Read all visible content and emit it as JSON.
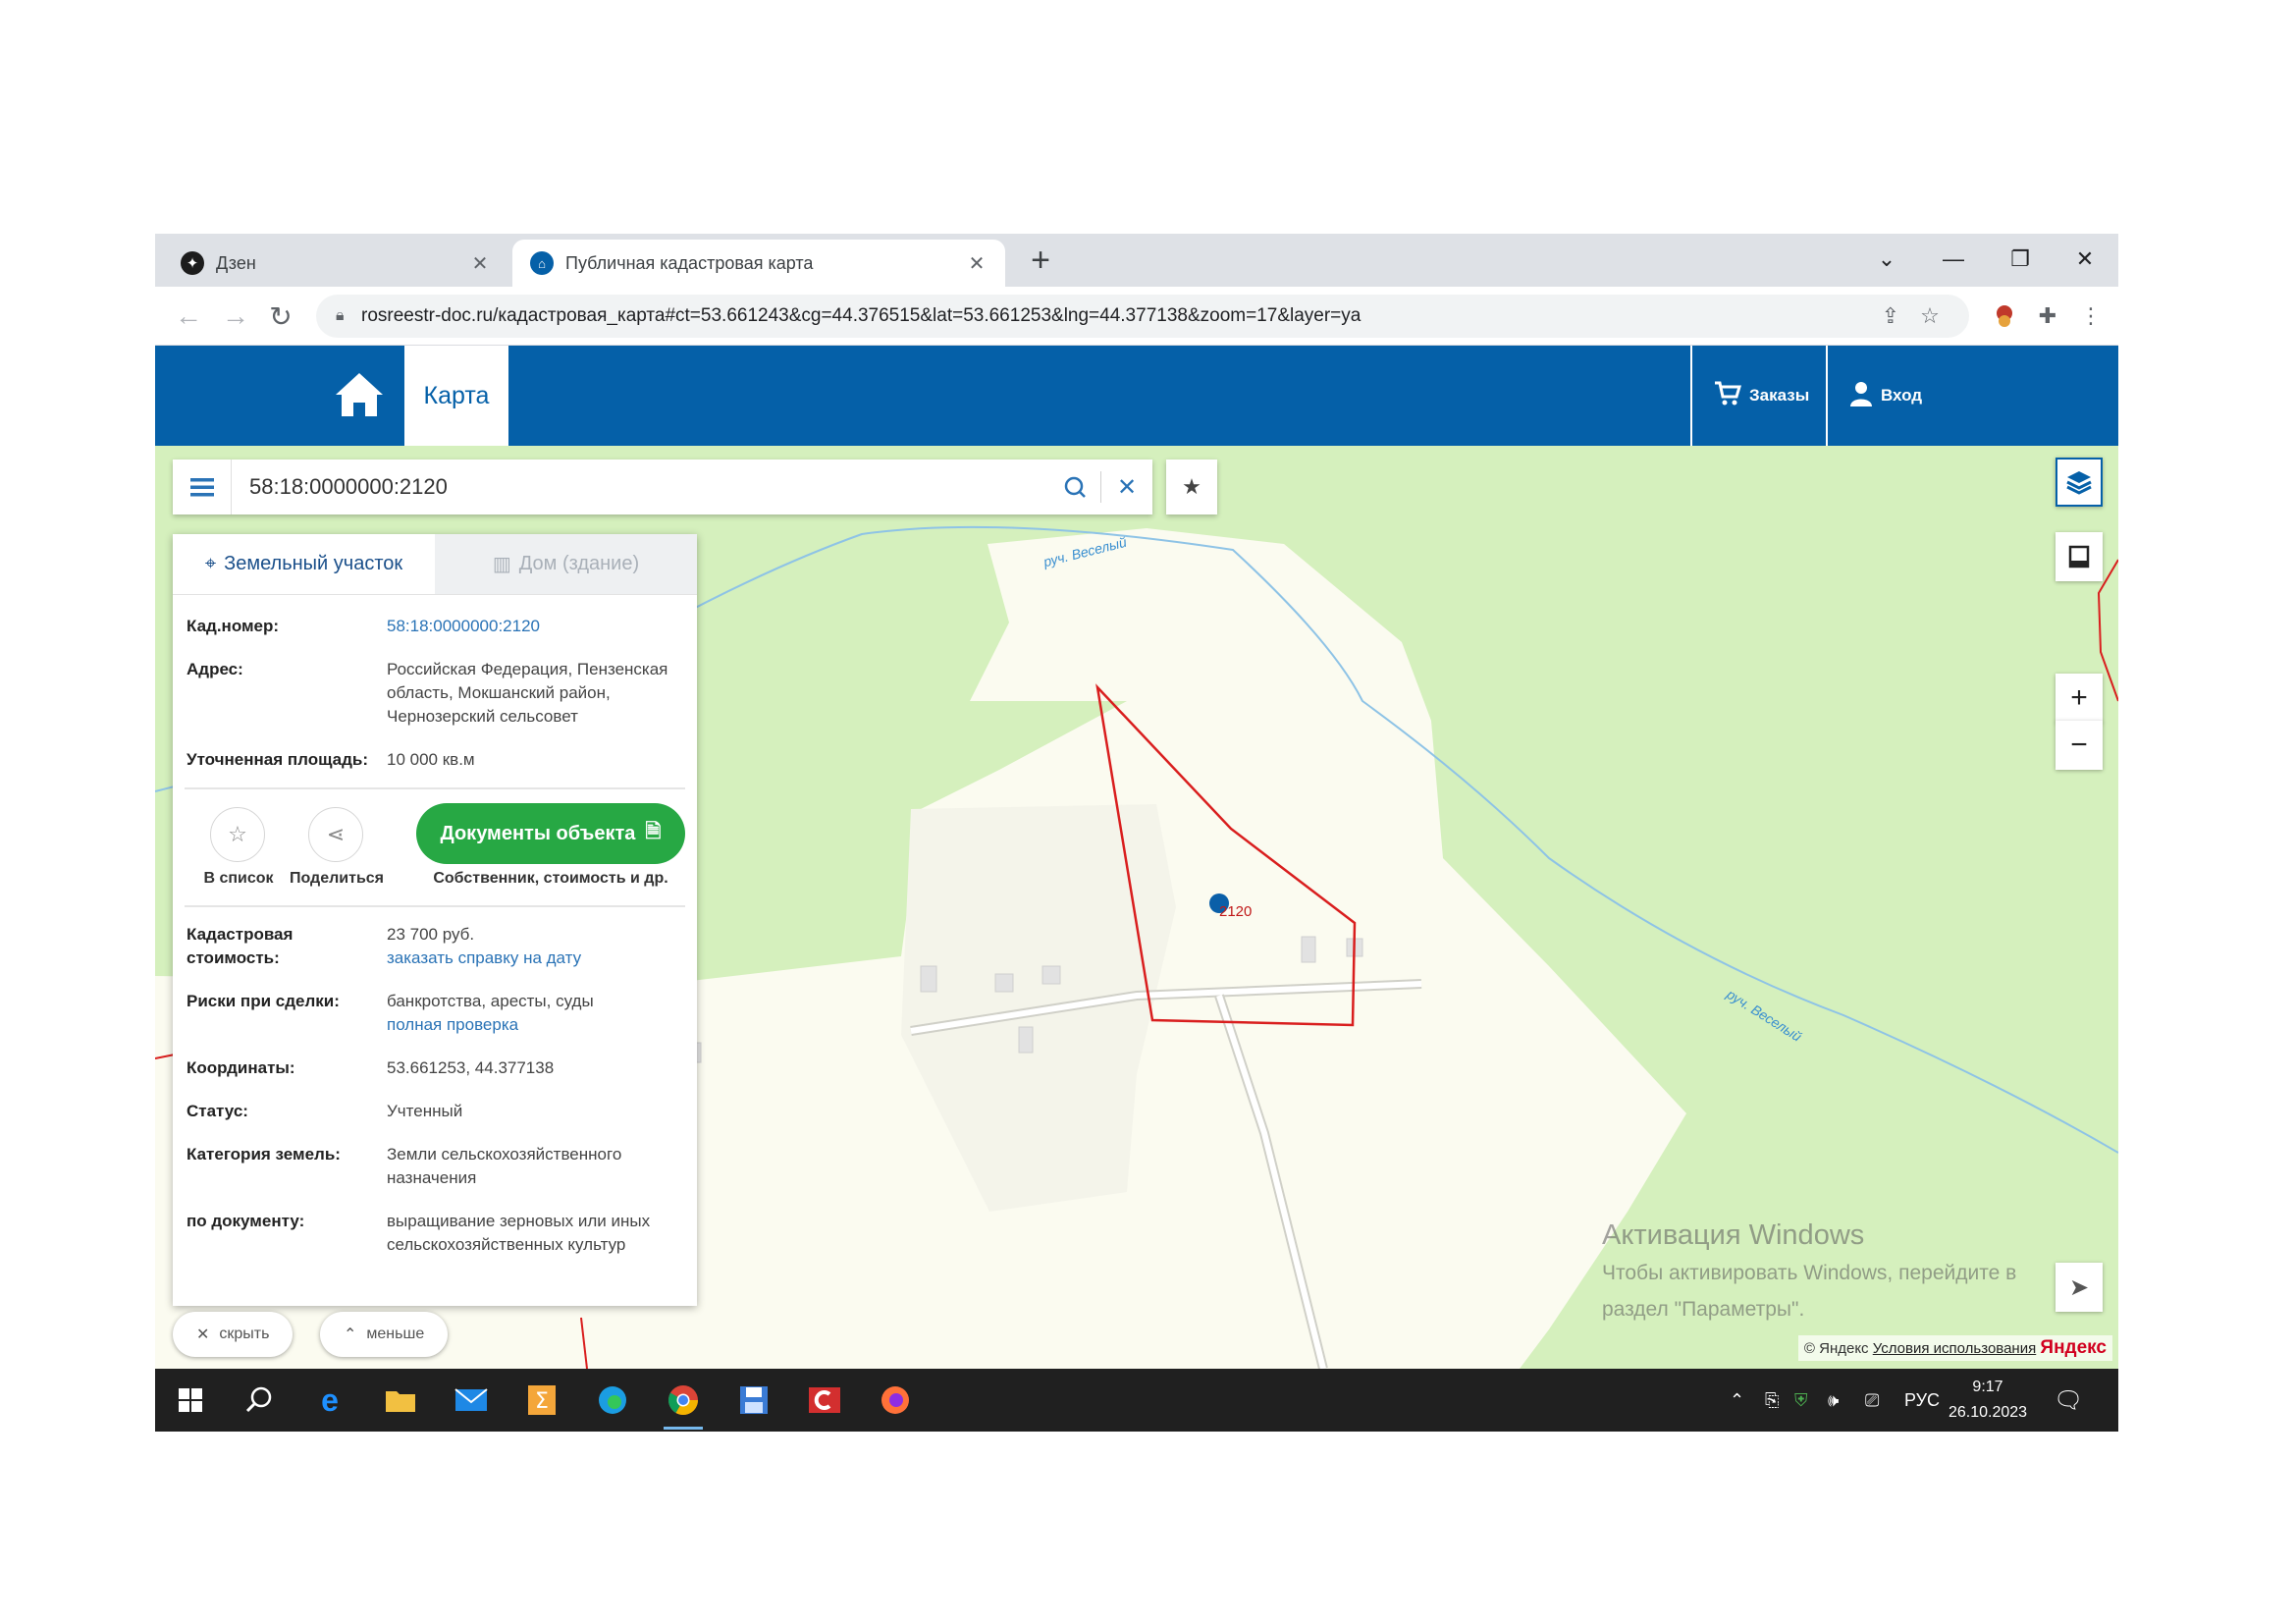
{
  "browser": {
    "tabs": [
      {
        "title": "Дзен",
        "icon": "dzen-icon"
      },
      {
        "title": "Публичная кадастровая карта",
        "icon": "home-icon"
      }
    ],
    "new_tab": "+",
    "url": "rosreestr-doc.ru/кадастровая_карта#ct=53.661243&cg=44.376515&lat=53.661253&lng=44.377138&zoom=17&layer=ya"
  },
  "site": {
    "map_tab": "Карта",
    "orders": "Заказы",
    "login": "Вход",
    "brand_color": "#0560a8"
  },
  "search": {
    "value": "58:18:0000000:2120"
  },
  "panel": {
    "tabs": [
      "Земельный участок",
      "Дом (здание)"
    ],
    "rows_top": [
      {
        "label": "Кад.номер:",
        "value": "58:18:0000000:2120",
        "link": true
      },
      {
        "label": "Адрес:",
        "value": "Российская Федерация, Пензенская область, Мокшанский район, Чернозерский сельсовет"
      },
      {
        "label": "Уточненная площадь:",
        "value": "10 000 кв.м"
      }
    ],
    "actions": {
      "list": "В список",
      "share": "Поделиться",
      "documents": "Документы объекта",
      "documents_sub": "Собственник, стоимость и др."
    },
    "cadastral": {
      "label": "Кадастровая стоимость:",
      "value": "23 700 руб.",
      "link": "заказать справку на дату"
    },
    "risks": {
      "label": "Риски при сделки:",
      "value": "банкротства, аресты, суды",
      "link": "полная проверка"
    },
    "rows_bottom": [
      {
        "label": "Координаты:",
        "value": "53.661253, 44.377138"
      },
      {
        "label": "Статус:",
        "value": "Учтенный"
      },
      {
        "label": "Категория земель:",
        "value": "Земли сельскохозяйственного назначения"
      },
      {
        "label": "по документу:",
        "value": "выращивание зерновых или иных сельскохозяйственных культур"
      }
    ],
    "hide": "скрыть",
    "less": "меньше"
  },
  "map": {
    "river_label": "руч. Веселый",
    "parcel_label": "2120",
    "zoom_in": "+",
    "zoom_out": "−",
    "copyright": "© Яндекс",
    "terms": "Условия использования",
    "yandex": "Яндекс"
  },
  "watermark": {
    "title": "Активация Windows",
    "line1": "Чтобы активировать Windows, перейдите в",
    "line2": "раздел \"Параметры\"."
  },
  "taskbar": {
    "lang": "РУС",
    "time": "9:17",
    "date": "26.10.2023"
  }
}
